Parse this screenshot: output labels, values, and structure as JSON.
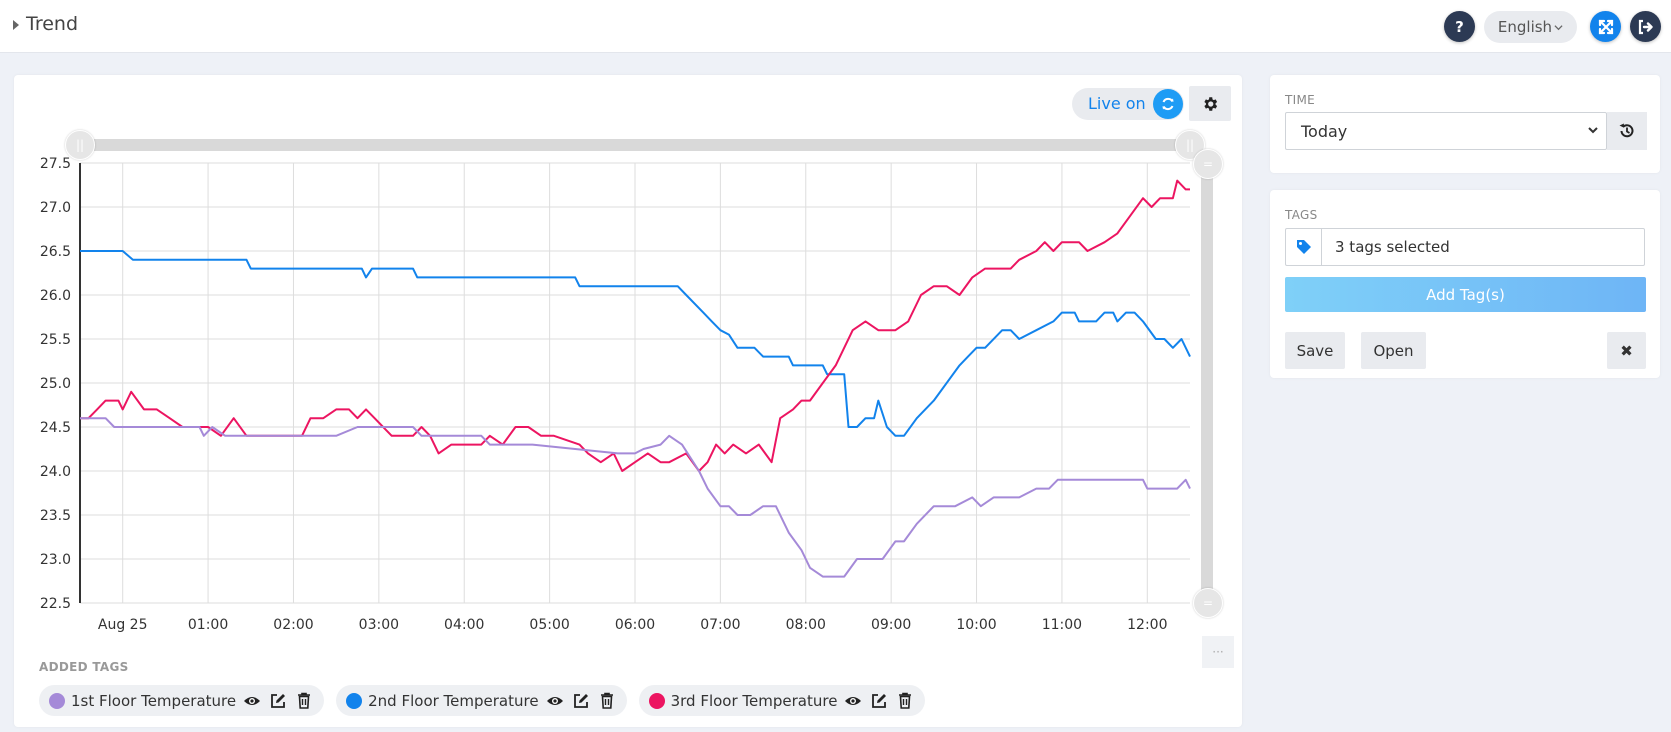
{
  "header": {
    "title": "Trend",
    "help_label": "?",
    "language": "English"
  },
  "live": {
    "label": "Live on"
  },
  "time": {
    "section_label": "TIME",
    "selected": "Today"
  },
  "tags": {
    "section_label": "TAGS",
    "summary": "3 tags selected",
    "add_button": "Add Tag(s)",
    "save_button": "Save",
    "open_button": "Open",
    "close_button": "✖"
  },
  "added_tags": {
    "label": "ADDED TAGS",
    "items": [
      {
        "name": "1st Floor Temperature",
        "color": "#a58ad8"
      },
      {
        "name": "2nd Floor Temperature",
        "color": "#1283ec"
      },
      {
        "name": "3rd Floor Temperature",
        "color": "#ec1561"
      }
    ]
  },
  "colors": {
    "accent": "#1283ec",
    "dark": "#2c3a54"
  },
  "chart_data": {
    "type": "line",
    "xlabel": "",
    "ylabel": "",
    "ylim": [
      22.5,
      27.5
    ],
    "xlim": [
      -0.5,
      12.5
    ],
    "x_tick_labels": [
      "Aug 25",
      "01:00",
      "02:00",
      "03:00",
      "04:00",
      "05:00",
      "06:00",
      "07:00",
      "08:00",
      "09:00",
      "10:00",
      "11:00",
      "12:00"
    ],
    "y_ticks": [
      27.5,
      27.0,
      26.5,
      26.0,
      25.5,
      25.0,
      24.5,
      24.0,
      23.5,
      23.0,
      22.5
    ],
    "grid": true,
    "series": [
      {
        "name": "2nd Floor Temperature",
        "color": "#1283ec",
        "x": [
          -0.5,
          0.0,
          0.12,
          1.45,
          1.5,
          2.8,
          2.85,
          2.92,
          3.4,
          3.45,
          5.3,
          5.35,
          6.5,
          6.6,
          6.8,
          6.9,
          7.0,
          7.1,
          7.2,
          7.4,
          7.5,
          7.8,
          7.85,
          8.2,
          8.25,
          8.45,
          8.5,
          8.6,
          8.7,
          8.8,
          8.85,
          8.95,
          9.05,
          9.15,
          9.3,
          9.5,
          9.8,
          9.9,
          10.0,
          10.1,
          10.3,
          10.4,
          10.5,
          10.7,
          10.9,
          11.0,
          11.15,
          11.2,
          11.4,
          11.5,
          11.6,
          11.65,
          11.75,
          11.85,
          11.95,
          12.1,
          12.2,
          12.3,
          12.4,
          12.5
        ],
        "values": [
          26.5,
          26.5,
          26.4,
          26.4,
          26.3,
          26.3,
          26.2,
          26.3,
          26.3,
          26.2,
          26.2,
          26.1,
          26.1,
          26.0,
          25.8,
          25.7,
          25.6,
          25.55,
          25.4,
          25.4,
          25.3,
          25.3,
          25.2,
          25.2,
          25.1,
          25.1,
          24.5,
          24.5,
          24.6,
          24.6,
          24.8,
          24.5,
          24.4,
          24.4,
          24.6,
          24.8,
          25.2,
          25.3,
          25.4,
          25.4,
          25.6,
          25.6,
          25.5,
          25.6,
          25.7,
          25.8,
          25.8,
          25.7,
          25.7,
          25.8,
          25.8,
          25.7,
          25.8,
          25.8,
          25.7,
          25.5,
          25.5,
          25.4,
          25.5,
          25.3
        ]
      },
      {
        "name": "3rd Floor Temperature",
        "color": "#ec1561",
        "x": [
          -0.5,
          -0.4,
          -0.3,
          -0.2,
          -0.05,
          0.0,
          0.1,
          0.25,
          0.4,
          0.55,
          0.7,
          0.85,
          1.0,
          1.15,
          1.3,
          1.45,
          2.0,
          2.1,
          2.2,
          2.35,
          2.5,
          2.65,
          2.75,
          2.85,
          2.95,
          3.15,
          3.4,
          3.5,
          3.6,
          3.7,
          3.85,
          4.0,
          4.2,
          4.3,
          4.45,
          4.6,
          4.75,
          4.9,
          5.05,
          5.35,
          5.45,
          5.6,
          5.75,
          5.85,
          6.0,
          6.15,
          6.3,
          6.4,
          6.6,
          6.75,
          6.85,
          6.95,
          7.05,
          7.15,
          7.3,
          7.45,
          7.6,
          7.7,
          7.85,
          7.95,
          8.05,
          8.2,
          8.35,
          8.45,
          8.55,
          8.7,
          8.85,
          9.05,
          9.2,
          9.35,
          9.5,
          9.65,
          9.8,
          9.95,
          10.1,
          10.2,
          10.4,
          10.5,
          10.7,
          10.8,
          10.9,
          11.0,
          11.2,
          11.3,
          11.5,
          11.65,
          11.8,
          11.95,
          12.05,
          12.15,
          12.3,
          12.35,
          12.45,
          12.5
        ],
        "values": [
          24.6,
          24.6,
          24.7,
          24.8,
          24.8,
          24.7,
          24.9,
          24.7,
          24.7,
          24.6,
          24.5,
          24.5,
          24.5,
          24.4,
          24.6,
          24.4,
          24.4,
          24.4,
          24.6,
          24.6,
          24.7,
          24.7,
          24.6,
          24.7,
          24.6,
          24.4,
          24.4,
          24.5,
          24.4,
          24.2,
          24.3,
          24.3,
          24.3,
          24.4,
          24.3,
          24.5,
          24.5,
          24.4,
          24.4,
          24.3,
          24.2,
          24.1,
          24.2,
          24.0,
          24.1,
          24.2,
          24.1,
          24.1,
          24.2,
          24.0,
          24.1,
          24.3,
          24.2,
          24.3,
          24.2,
          24.3,
          24.1,
          24.6,
          24.7,
          24.8,
          24.8,
          25.0,
          25.2,
          25.4,
          25.6,
          25.7,
          25.6,
          25.6,
          25.7,
          26.0,
          26.1,
          26.1,
          26.0,
          26.2,
          26.3,
          26.3,
          26.3,
          26.4,
          26.5,
          26.6,
          26.5,
          26.6,
          26.6,
          26.5,
          26.6,
          26.7,
          26.9,
          27.1,
          27.0,
          27.1,
          27.1,
          27.3,
          27.2,
          27.2
        ]
      },
      {
        "name": "1st Floor Temperature",
        "color": "#a58ad8",
        "x": [
          -0.5,
          -0.2,
          -0.1,
          0.0,
          0.5,
          0.9,
          0.95,
          1.05,
          1.2,
          1.4,
          2.4,
          2.5,
          2.75,
          3.4,
          3.5,
          4.1,
          4.2,
          4.3,
          4.8,
          5.8,
          6.0,
          6.1,
          6.3,
          6.4,
          6.55,
          6.75,
          6.85,
          7.0,
          7.1,
          7.2,
          7.35,
          7.5,
          7.65,
          7.8,
          7.95,
          8.05,
          8.2,
          8.3,
          8.45,
          8.6,
          8.7,
          8.9,
          9.05,
          9.15,
          9.3,
          9.5,
          9.6,
          9.75,
          9.95,
          10.05,
          10.2,
          10.5,
          10.7,
          10.85,
          10.95,
          11.05,
          11.5,
          11.95,
          12.0,
          12.35,
          12.45,
          12.5
        ],
        "values": [
          24.6,
          24.6,
          24.5,
          24.5,
          24.5,
          24.5,
          24.4,
          24.5,
          24.4,
          24.4,
          24.4,
          24.4,
          24.5,
          24.5,
          24.4,
          24.4,
          24.4,
          24.3,
          24.3,
          24.2,
          24.2,
          24.25,
          24.3,
          24.4,
          24.3,
          24.0,
          23.8,
          23.6,
          23.6,
          23.5,
          23.5,
          23.6,
          23.6,
          23.3,
          23.1,
          22.9,
          22.8,
          22.8,
          22.8,
          23.0,
          23.0,
          23.0,
          23.2,
          23.2,
          23.4,
          23.6,
          23.6,
          23.6,
          23.7,
          23.6,
          23.7,
          23.7,
          23.8,
          23.8,
          23.9,
          23.9,
          23.9,
          23.9,
          23.8,
          23.8,
          23.9,
          23.8
        ]
      }
    ]
  }
}
